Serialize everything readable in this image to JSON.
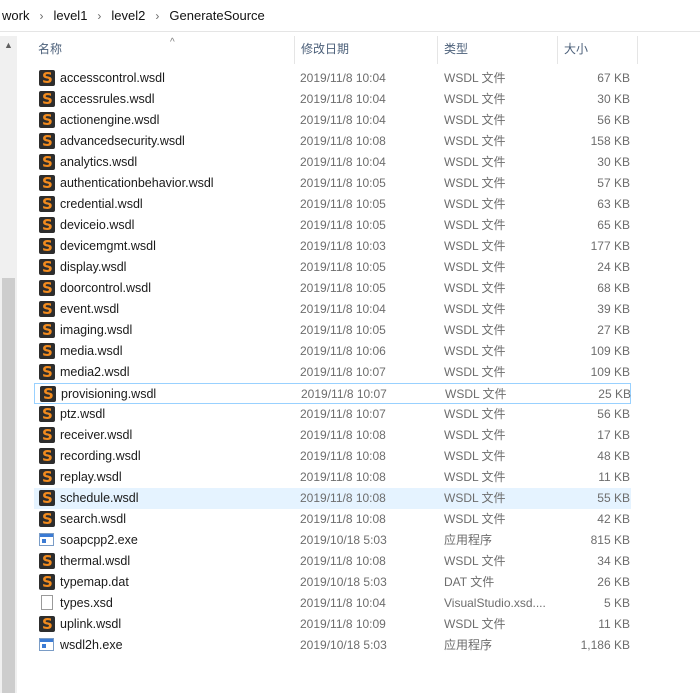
{
  "breadcrumb": [
    "work",
    "level1",
    "level2",
    "GenerateSource"
  ],
  "columns": {
    "name": "名称",
    "date": "修改日期",
    "type": "类型",
    "size": "大小"
  },
  "files": [
    {
      "name": "accesscontrol.wsdl",
      "date": "2019/11/8 10:04",
      "type": "WSDL 文件",
      "size": "67 KB",
      "icon": "wsdl-icon"
    },
    {
      "name": "accessrules.wsdl",
      "date": "2019/11/8 10:04",
      "type": "WSDL 文件",
      "size": "30 KB",
      "icon": "wsdl-icon"
    },
    {
      "name": "actionengine.wsdl",
      "date": "2019/11/8 10:04",
      "type": "WSDL 文件",
      "size": "56 KB",
      "icon": "wsdl-icon"
    },
    {
      "name": "advancedsecurity.wsdl",
      "date": "2019/11/8 10:08",
      "type": "WSDL 文件",
      "size": "158 KB",
      "icon": "wsdl-icon"
    },
    {
      "name": "analytics.wsdl",
      "date": "2019/11/8 10:04",
      "type": "WSDL 文件",
      "size": "30 KB",
      "icon": "wsdl-icon"
    },
    {
      "name": "authenticationbehavior.wsdl",
      "date": "2019/11/8 10:05",
      "type": "WSDL 文件",
      "size": "57 KB",
      "icon": "wsdl-icon"
    },
    {
      "name": "credential.wsdl",
      "date": "2019/11/8 10:05",
      "type": "WSDL 文件",
      "size": "63 KB",
      "icon": "wsdl-icon"
    },
    {
      "name": "deviceio.wsdl",
      "date": "2019/11/8 10:05",
      "type": "WSDL 文件",
      "size": "65 KB",
      "icon": "wsdl-icon"
    },
    {
      "name": "devicemgmt.wsdl",
      "date": "2019/11/8 10:03",
      "type": "WSDL 文件",
      "size": "177 KB",
      "icon": "wsdl-icon"
    },
    {
      "name": "display.wsdl",
      "date": "2019/11/8 10:05",
      "type": "WSDL 文件",
      "size": "24 KB",
      "icon": "wsdl-icon"
    },
    {
      "name": "doorcontrol.wsdl",
      "date": "2019/11/8 10:05",
      "type": "WSDL 文件",
      "size": "68 KB",
      "icon": "wsdl-icon"
    },
    {
      "name": "event.wsdl",
      "date": "2019/11/8 10:04",
      "type": "WSDL 文件",
      "size": "39 KB",
      "icon": "wsdl-icon"
    },
    {
      "name": "imaging.wsdl",
      "date": "2019/11/8 10:05",
      "type": "WSDL 文件",
      "size": "27 KB",
      "icon": "wsdl-icon"
    },
    {
      "name": "media.wsdl",
      "date": "2019/11/8 10:06",
      "type": "WSDL 文件",
      "size": "109 KB",
      "icon": "wsdl-icon"
    },
    {
      "name": "media2.wsdl",
      "date": "2019/11/8 10:07",
      "type": "WSDL 文件",
      "size": "109 KB",
      "icon": "wsdl-icon"
    },
    {
      "name": "provisioning.wsdl",
      "date": "2019/11/8 10:07",
      "type": "WSDL 文件",
      "size": "25 KB",
      "icon": "wsdl-icon",
      "state": "focused"
    },
    {
      "name": "ptz.wsdl",
      "date": "2019/11/8 10:07",
      "type": "WSDL 文件",
      "size": "56 KB",
      "icon": "wsdl-icon"
    },
    {
      "name": "receiver.wsdl",
      "date": "2019/11/8 10:08",
      "type": "WSDL 文件",
      "size": "17 KB",
      "icon": "wsdl-icon"
    },
    {
      "name": "recording.wsdl",
      "date": "2019/11/8 10:08",
      "type": "WSDL 文件",
      "size": "48 KB",
      "icon": "wsdl-icon"
    },
    {
      "name": "replay.wsdl",
      "date": "2019/11/8 10:08",
      "type": "WSDL 文件",
      "size": "11 KB",
      "icon": "wsdl-icon"
    },
    {
      "name": "schedule.wsdl",
      "date": "2019/11/8 10:08",
      "type": "WSDL 文件",
      "size": "55 KB",
      "icon": "wsdl-icon",
      "state": "hovered"
    },
    {
      "name": "search.wsdl",
      "date": "2019/11/8 10:08",
      "type": "WSDL 文件",
      "size": "42 KB",
      "icon": "wsdl-icon"
    },
    {
      "name": "soapcpp2.exe",
      "date": "2019/10/18 5:03",
      "type": "应用程序",
      "size": "815 KB",
      "icon": "exe-icon"
    },
    {
      "name": "thermal.wsdl",
      "date": "2019/11/8 10:08",
      "type": "WSDL 文件",
      "size": "34 KB",
      "icon": "wsdl-icon"
    },
    {
      "name": "typemap.dat",
      "date": "2019/10/18 5:03",
      "type": "DAT 文件",
      "size": "26 KB",
      "icon": "wsdl-icon"
    },
    {
      "name": "types.xsd",
      "date": "2019/11/8 10:04",
      "type": "VisualStudio.xsd....",
      "size": "5 KB",
      "icon": "blank-file-icon"
    },
    {
      "name": "uplink.wsdl",
      "date": "2019/11/8 10:09",
      "type": "WSDL 文件",
      "size": "11 KB",
      "icon": "wsdl-icon"
    },
    {
      "name": "wsdl2h.exe",
      "date": "2019/10/18 5:03",
      "type": "应用程序",
      "size": "1,186 KB",
      "icon": "exe-icon"
    }
  ]
}
